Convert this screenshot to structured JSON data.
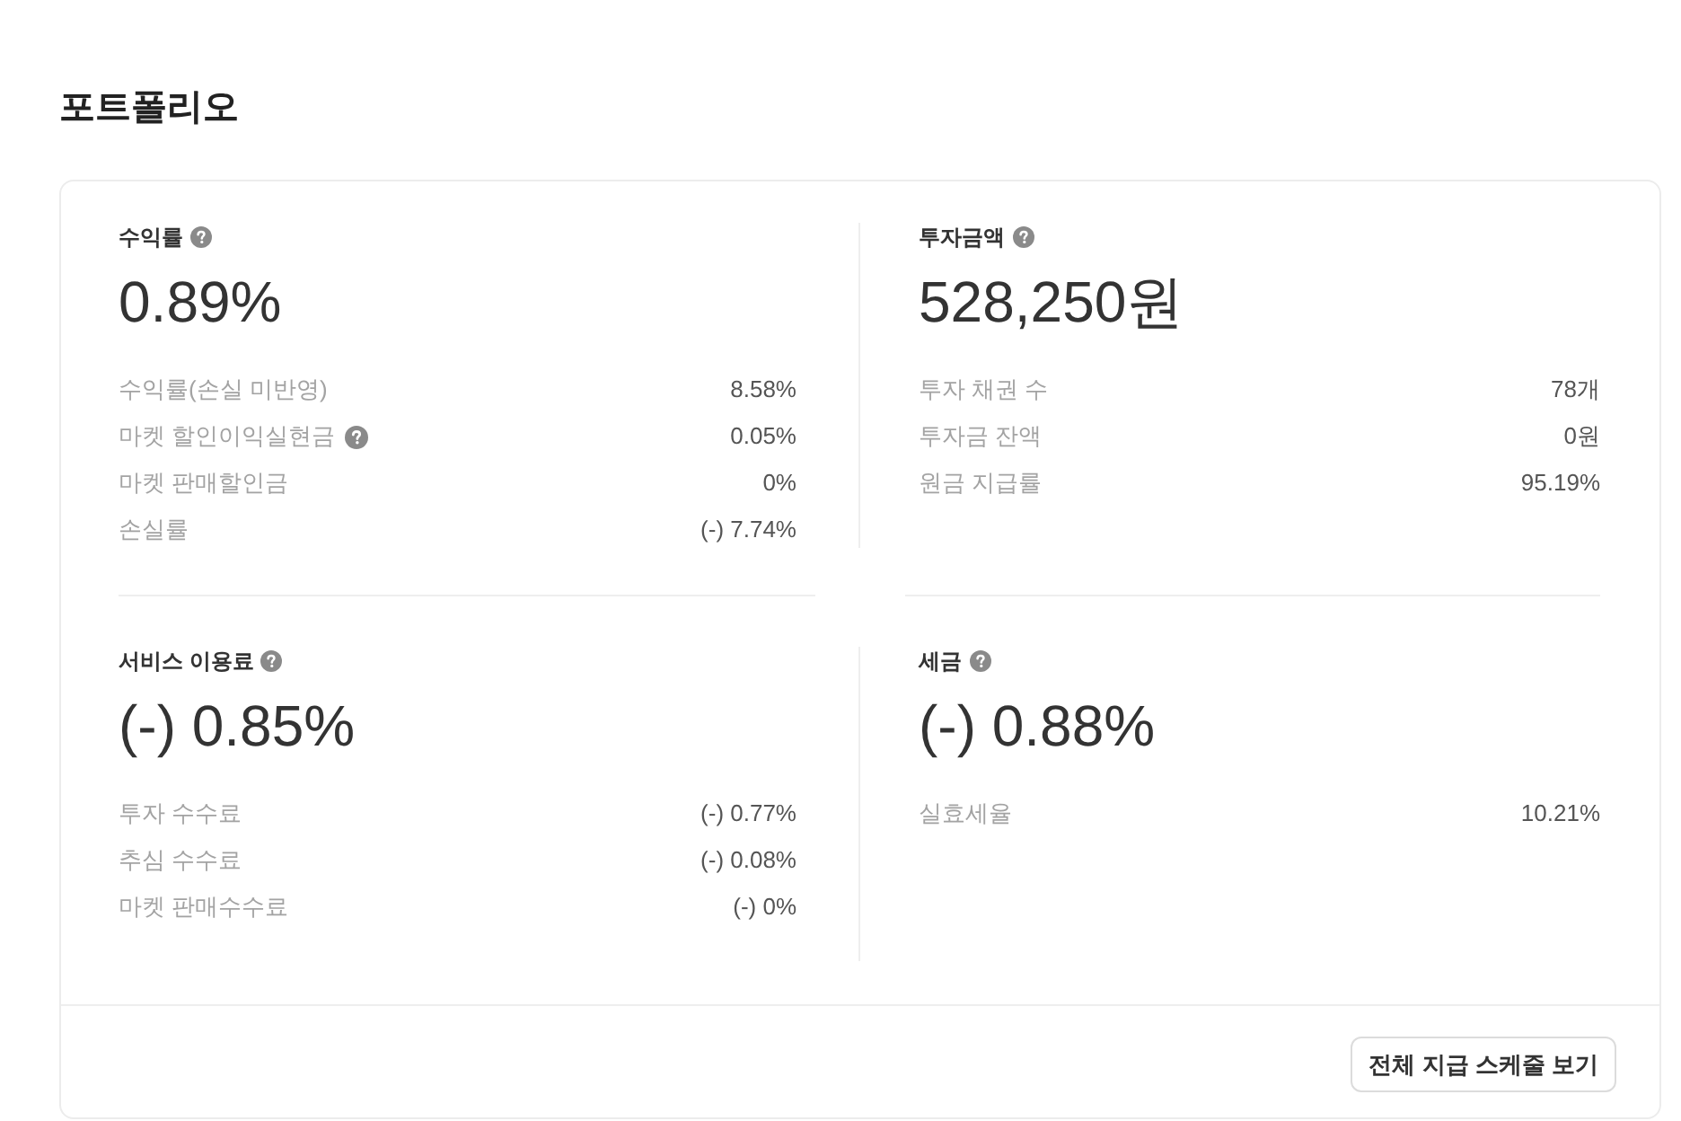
{
  "title": "포트폴리오",
  "sections": [
    {
      "label": "수익률",
      "help": true,
      "value": "0.89%",
      "rows": [
        {
          "label": "수익률(손실 미반영)",
          "help": false,
          "value": "8.58%"
        },
        {
          "label": "마켓 할인이익실현금",
          "help": true,
          "value": "0.05%"
        },
        {
          "label": "마켓 판매할인금",
          "help": false,
          "value": "0%"
        },
        {
          "label": "손실률",
          "help": false,
          "value": "(-) 7.74%"
        }
      ]
    },
    {
      "label": "투자금액",
      "help": true,
      "value": "528,250원",
      "rows": [
        {
          "label": "투자 채권 수",
          "help": false,
          "value": "78개"
        },
        {
          "label": "투자금 잔액",
          "help": false,
          "value": "0원"
        },
        {
          "label": "원금 지급률",
          "help": false,
          "value": "95.19%"
        }
      ]
    },
    {
      "label": "서비스 이용료",
      "help": true,
      "value": "(-) 0.85%",
      "rows": [
        {
          "label": "투자 수수료",
          "help": false,
          "value": "(-) 0.77%"
        },
        {
          "label": "추심 수수료",
          "help": false,
          "value": "(-) 0.08%"
        },
        {
          "label": "마켓 판매수수료",
          "help": false,
          "value": "(-) 0%"
        }
      ]
    },
    {
      "label": "세금",
      "help": true,
      "value": "(-) 0.88%",
      "rows": [
        {
          "label": "실효세율",
          "help": false,
          "value": "10.21%"
        }
      ]
    }
  ],
  "footer": {
    "button": "전체 지급 스케줄 보기"
  }
}
